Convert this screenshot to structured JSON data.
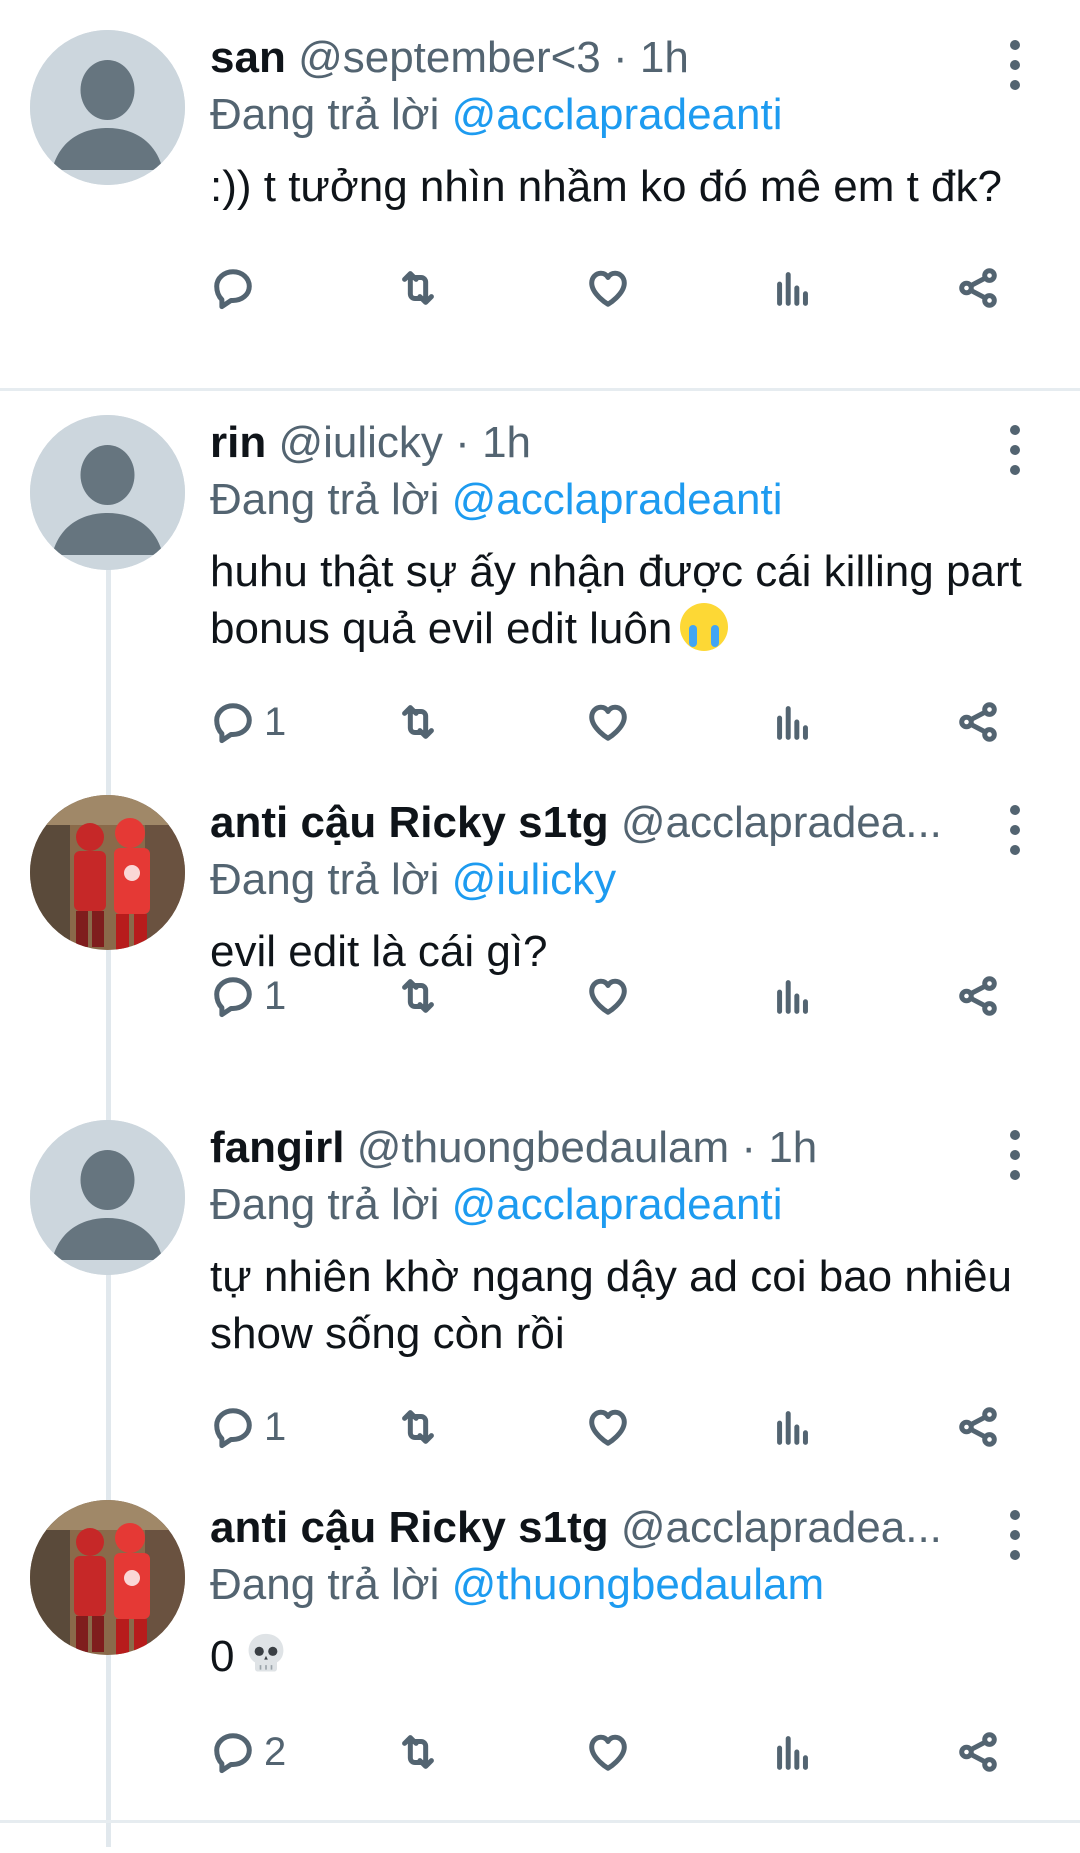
{
  "colors": {
    "text": "#0f1419",
    "secondary": "#536471",
    "link": "#1d9bf0",
    "divider": "#e6ecf0"
  },
  "icons": [
    "reply-icon",
    "retweet-icon",
    "like-icon",
    "views-icon",
    "share-icon",
    "more-options-icon"
  ],
  "tweets": [
    {
      "name": "san",
      "handle": "@september<3",
      "dot": "·",
      "time": "1h",
      "replying_prefix": "Đang trả lời",
      "replying_to": "@acclapradeanti",
      "text": ":)) t tưởng nhìn nhầm ko đó mê em t đk?",
      "reply_count": ""
    },
    {
      "name": "rin",
      "handle": "@iulicky",
      "dot": "·",
      "time": "1h",
      "replying_prefix": "Đang trả lời",
      "replying_to": "@acclapradeanti",
      "text": "huhu thật sự ấy nhận được cái killing part bonus quả evil edit luôn",
      "emoji": "loudly-crying-face",
      "reply_count": "1"
    },
    {
      "name": "anti cậu Ricky s1tg",
      "handle": "@acclapradea...",
      "replying_prefix": "Đang trả lời",
      "replying_to": "@iulicky",
      "text": "evil edit là cái gì?",
      "reply_count": "1"
    },
    {
      "name": "fangirl",
      "handle": "@thuongbedaulam",
      "dot": "·",
      "time": "1h",
      "replying_prefix": "Đang trả lời",
      "replying_to": "@acclapradeanti",
      "text": "tự nhiên khờ ngang dậy ad coi bao nhiêu show sống còn rồi",
      "reply_count": "1"
    },
    {
      "name": "anti cậu Ricky s1tg",
      "handle": "@acclapradea...",
      "replying_prefix": "Đang trả lời",
      "replying_to": "@thuongbedaulam",
      "text": "0",
      "emoji": "skull",
      "reply_count": "2"
    }
  ]
}
